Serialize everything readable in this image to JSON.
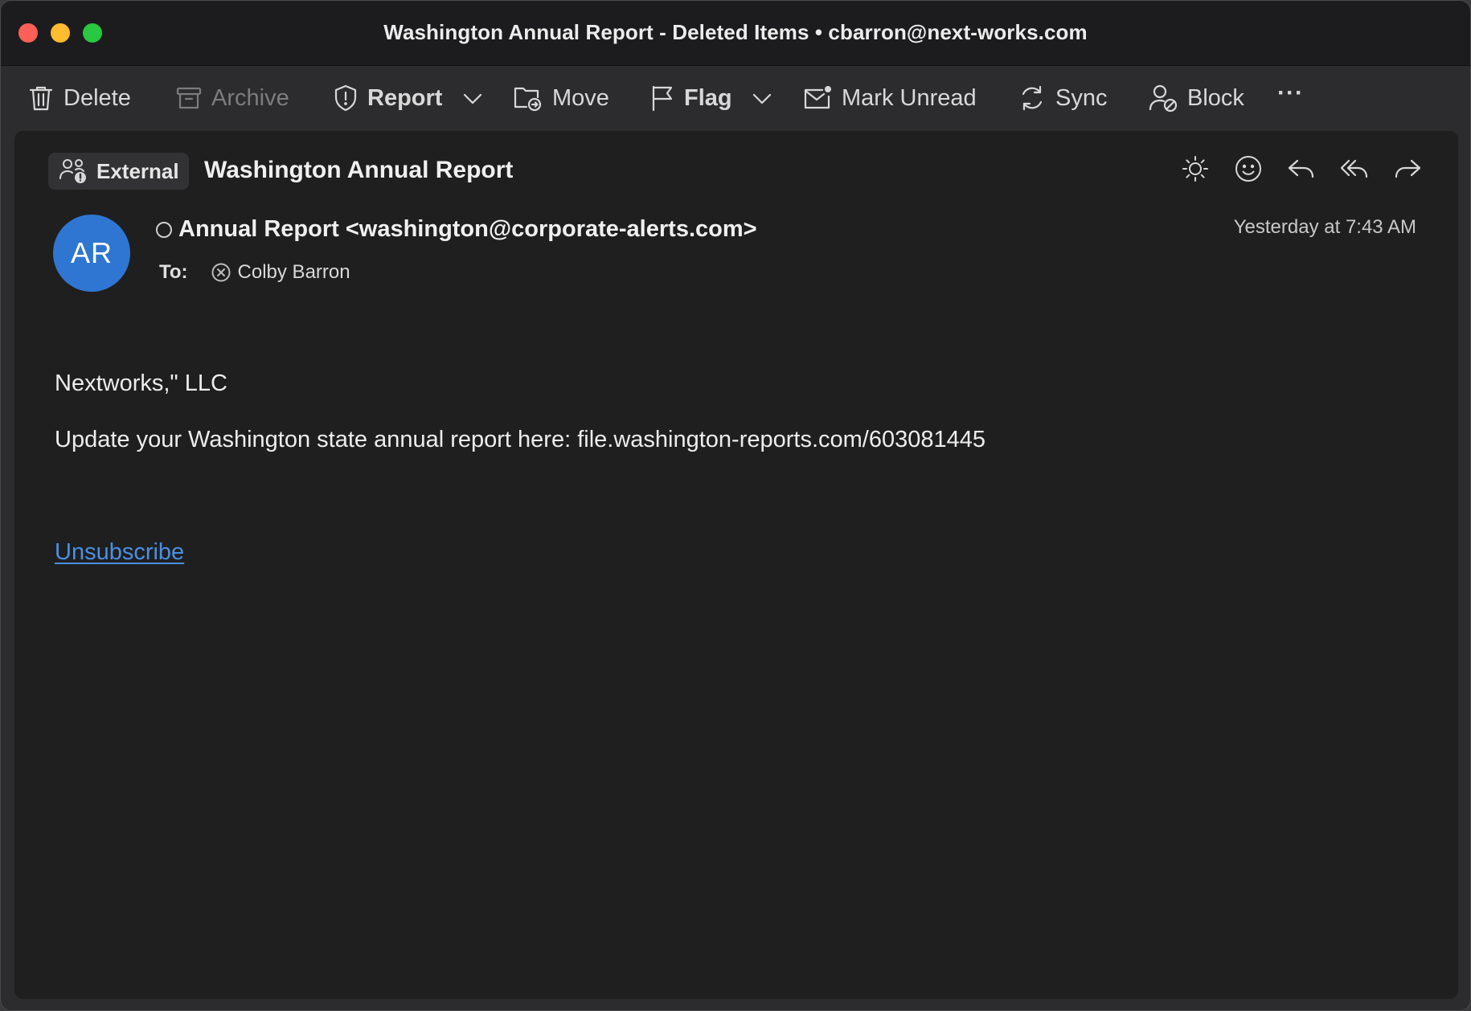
{
  "window": {
    "title": "Washington Annual Report - Deleted Items • cbarron@next-works.com"
  },
  "toolbar": {
    "delete_label": "Delete",
    "archive_label": "Archive",
    "report_label": "Report",
    "move_label": "Move",
    "flag_label": "Flag",
    "mark_unread_label": "Mark Unread",
    "sync_label": "Sync",
    "block_label": "Block",
    "more_label": "···"
  },
  "message": {
    "external_badge": "External",
    "subject": "Washington Annual Report",
    "avatar_initials": "AR",
    "avatar_color": "#2f76d2",
    "sender": "Annual Report <washington@corporate-alerts.com>",
    "timestamp": "Yesterday at 7:43 AM",
    "to_label": "To:",
    "recipient": "Colby Barron",
    "body": {
      "line1": "Nextworks,\" LLC",
      "line2": "Update your Washington state annual report here: file.washington-reports.com/603081445",
      "unsubscribe": "Unsubscribe"
    }
  },
  "colors": {
    "link": "#4a90e2",
    "close": "#fe5f57",
    "minimize": "#febc2e",
    "maximize": "#28c840"
  }
}
